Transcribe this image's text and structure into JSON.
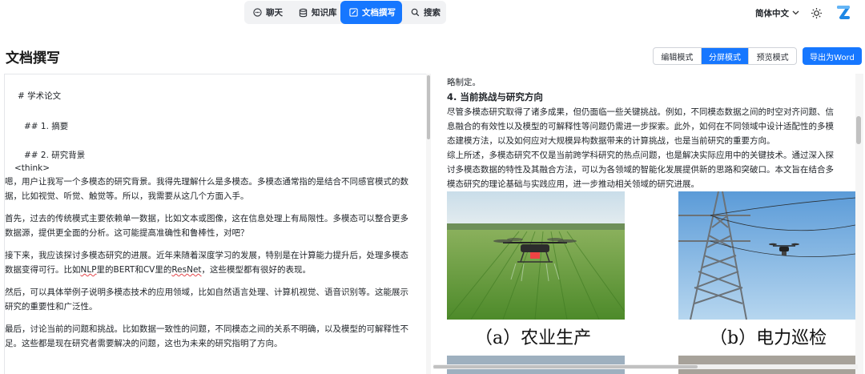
{
  "nav": {
    "tabs": [
      {
        "label": "聊天",
        "icon": "chat-icon"
      },
      {
        "label": "知识库",
        "icon": "database-icon"
      },
      {
        "label": "文档撰写",
        "icon": "edit-icon",
        "active": true
      },
      {
        "label": "搜索",
        "icon": "search-icon"
      }
    ],
    "language": "简体中文",
    "accent": "#1677ff"
  },
  "header": {
    "title": "文档撰写",
    "modes": [
      "编辑模式",
      "分屏模式",
      "预览模式"
    ],
    "active_mode": "分屏模式",
    "export_label": "导出为Word"
  },
  "editor": {
    "h1": "# 学术论文",
    "h2a": "## 1. 摘要",
    "h2b": "## 2. 研究背景",
    "think": "<think>",
    "p1": "嗯，用户让我写一个多模态的研究背景。我得先理解什么是多模态。多模态通常指的是结合不同感官模式的数据，比如视觉、听觉、触觉等。所以，我需要从这几个方面入手。",
    "p2": "首先，过去的传统模式主要依赖单一数据，比如文本或图像，这在信息处理上有局限性。多模态可以整合更多数据源，提供更全面的分析。这可能提高准确性和鲁棒性，对吧？",
    "p3a": "接下来，我应该探讨多模态研究的进展。近年来随着深度学习的发展，特别是在计算能力提升后，处理多模态数据变得可行。比如",
    "p3b": "NLP",
    "p3c": "里的BERT和CV里的",
    "p3d": "ResNet",
    "p3e": "，这些模型都有很好的表现。",
    "p4": "然后，可以具体举例子说明多模态技术的应用领域，比如自然语言处理、计算机视觉、语音识别等。这能展示研究的重要性和广泛性。",
    "p5": "最后，讨论当前的问题和挑战。比如数据一致性的问题，不同模态之间的关系不明确，以及模型的可解释性不足。这些都是现在研究者需要解决的问题，这也为未来的研究指明了方向。"
  },
  "preview": {
    "top_line": "略制定。",
    "heading": "4. 当前挑战与研究方向",
    "para1": "尽管多模态研究取得了诸多成果，但仍面临一些关键挑战。例如，不同模态数据之间的时空对齐问题、信息融合的有效性以及模型的可解释性等问题仍需进一步探索。此外，如何在不同领域中设计适配性的多模态建模方法，以及如何应对大规模异构数据带来的计算挑战，也是当前研究的重要方向。",
    "para2": "综上所述，多模态研究不仅是当前跨学科研究的热点问题，也是解决实际应用中的关键技术。通过深入探讨多模态数据的特性及其融合方法，可以为各领域的智能化发展提供新的思路和突破口。本文旨在结合多模态研究的理论基础与实践应用，进一步推动相关领域的研究进展。",
    "caption_a": "（a）农业生产",
    "caption_b": "（b）电力巡检"
  }
}
